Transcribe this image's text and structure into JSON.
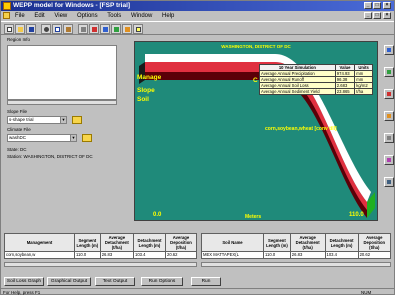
{
  "window": {
    "title": "WEPP model for Windows - [FSP trial]",
    "controls": [
      "_",
      "□",
      "×"
    ]
  },
  "menubar": {
    "items": [
      "File",
      "Edit",
      "View",
      "Options",
      "Tools",
      "Window",
      "Help"
    ],
    "child_controls": [
      "_",
      "□",
      "×"
    ]
  },
  "toolbar": {
    "icons": [
      "new-icon",
      "open-icon",
      "save-icon",
      "cut-icon",
      "copy-icon",
      "paste-icon",
      "print-icon",
      "undo-icon",
      "redo-icon",
      "chart-icon",
      "run-icon",
      "help-icon"
    ]
  },
  "left": {
    "region_label": "Region Info",
    "slope_label": "Slope File",
    "slope_value": "s-shape trial",
    "climate_label": "Climate File",
    "climate_value": "washDC",
    "state": "State: DC",
    "station": "Station: WASHINGTON, DISTRICT OF DC"
  },
  "plot": {
    "header": "WASHINGTON, DISTRICT OF DC",
    "management_label": "Manage",
    "slope_label": "Slope",
    "soil_label": "Soil",
    "crop_label": "corn,soybean,wheat [conv till]",
    "x_start": "0.0",
    "x_end": "110.0",
    "x_axis": "Meters",
    "c_label": "C",
    "colors": {
      "background": "#1f8a7a",
      "ribbon_top": "#ffffff",
      "ribbon_red": "#e03040",
      "ribbon_shadow": "#5a0008",
      "ribbon_side": "#20b020",
      "label": "#ffff00"
    }
  },
  "sim_table": {
    "headers": [
      "10 Year Simulation",
      "Value",
      "Units"
    ],
    "rows": [
      [
        "Average Annual Precipitation",
        "974.93",
        "mm"
      ],
      [
        "Average Annual Runoff",
        "96.38",
        "mm"
      ],
      [
        "Average Annual Soil Loss",
        "2.683",
        "kg/m2"
      ],
      [
        "Average Annual Sediment Yield",
        "23.865",
        "t/ha"
      ]
    ]
  },
  "mgmt_table": {
    "headers": [
      "Management",
      "Segment Length (m)",
      "Average Detachment (t/ha)",
      "Detachment Length (m)",
      "Average Deposition (t/ha)"
    ],
    "row": [
      "corn,soybean,w",
      "110.0",
      "26.83",
      "103.4",
      "20.62"
    ]
  },
  "soil_table": {
    "headers": [
      "Soil Name",
      "Segment Length (m)",
      "Average Detachment (t/ha)",
      "Detachment Length (m)",
      "Average Deposition (t/ha)"
    ],
    "row": [
      "MEX MATTAPEX(L",
      "110.0",
      "26.83",
      "103.4",
      "20.62"
    ]
  },
  "buttons": [
    "Soil Loss Graph",
    "Graphical Output",
    "Text Output",
    "Run Options",
    "Run"
  ],
  "status": {
    "left": "For Help, press F1",
    "right": "NUM"
  }
}
